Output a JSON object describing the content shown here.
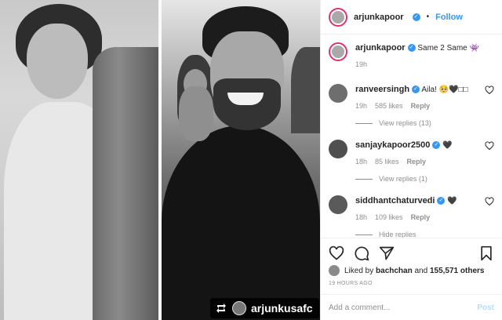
{
  "header": {
    "username": "arjunkapoor",
    "follow_label": "Follow",
    "dot": "•"
  },
  "caption": {
    "username": "arjunkapoor",
    "text": "Same 2 Same 👾",
    "time": "19h"
  },
  "comments": [
    {
      "username": "ranveersingh",
      "text": "Aila! 🥺🖤□□",
      "time": "19h",
      "likes": "585 likes",
      "reply_label": "Reply",
      "view_replies": "View replies (13)"
    },
    {
      "username": "sanjaykapoor2500",
      "text": "🖤",
      "time": "18h",
      "likes": "85 likes",
      "reply_label": "Reply",
      "view_replies": "View replies (1)"
    },
    {
      "username": "siddhantchaturvedi",
      "text": "🖤",
      "time": "18h",
      "likes": "109 likes",
      "reply_label": "Reply",
      "view_replies": "Hide replies"
    }
  ],
  "likes_line": {
    "prefix": "Liked by",
    "liker": "bachchan",
    "middle": "and",
    "others": "155,571 others"
  },
  "timestamp": "19 HOURS AGO",
  "add_comment": {
    "placeholder": "Add a comment...",
    "post_label": "Post"
  },
  "media": {
    "repost_username": "arjunkusafc"
  },
  "colors": {
    "accent": "#3897f0",
    "story_ring": "#e1306c",
    "muted": "#8e8e8e"
  },
  "icons": {
    "verified": "verified-badge-icon",
    "heart": "heart-icon",
    "comment": "comment-icon",
    "share": "share-icon",
    "save": "bookmark-icon",
    "repost": "repost-icon"
  }
}
